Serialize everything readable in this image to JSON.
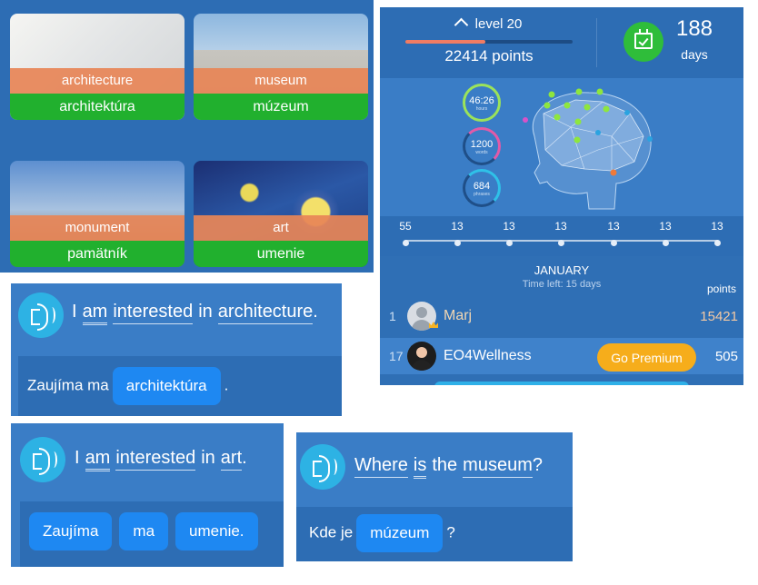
{
  "vocabulary": [
    {
      "english": "architecture",
      "slovak": "architektúra"
    },
    {
      "english": "museum",
      "slovak": "múzeum"
    },
    {
      "english": "monument",
      "slovak": "pamätník"
    },
    {
      "english": "art",
      "slovak": "umenie"
    }
  ],
  "stats": {
    "level": "level 20",
    "level_progress": 0.48,
    "points": "22414 points",
    "days_count": "188",
    "days_label": "days",
    "rings": [
      {
        "value": "46:26",
        "label": "hours"
      },
      {
        "value": "1200",
        "label": "words"
      },
      {
        "value": "684",
        "label": "phrases"
      }
    ],
    "streak": [
      "55",
      "13",
      "13",
      "13",
      "13",
      "13",
      "13"
    ]
  },
  "leaderboard": {
    "month": "JANUARY",
    "time_left": "Time left: 15 days",
    "points_header": "points",
    "rows": [
      {
        "rank": "1",
        "name": "Marj",
        "points": "15421"
      },
      {
        "rank": "17",
        "name": "EO4Wellness",
        "points": "505"
      }
    ],
    "premium_label": "Go Premium"
  },
  "sentences": [
    {
      "words": [
        "I",
        "am",
        "interested",
        "in",
        "architecture",
        "."
      ],
      "answer_prefix": "Zaujíma ma",
      "answer_chip": "architektúra",
      "answer_suffix": "."
    },
    {
      "words": [
        "I",
        "am",
        "interested",
        "in",
        "art",
        "."
      ],
      "answer_chips": [
        "Zaujíma",
        "ma",
        "umenie."
      ]
    },
    {
      "words": [
        "Where",
        "is",
        "the",
        "museum",
        "?"
      ],
      "answer_prefix": "Kde je",
      "answer_chip": "múzeum",
      "answer_suffix": "?"
    }
  ],
  "colors": {
    "panel_blue": "#2d6db4",
    "english_band": "#e78557",
    "slovak_band": "#21b02e",
    "chip_blue": "#1e88f2",
    "premium_orange": "#f6ad1b",
    "speaker_cyan": "#2db2e4"
  },
  "icons": [
    "speaker-icon",
    "calendar-check-icon",
    "chevron-up-icon",
    "crown-icon",
    "avatar"
  ]
}
